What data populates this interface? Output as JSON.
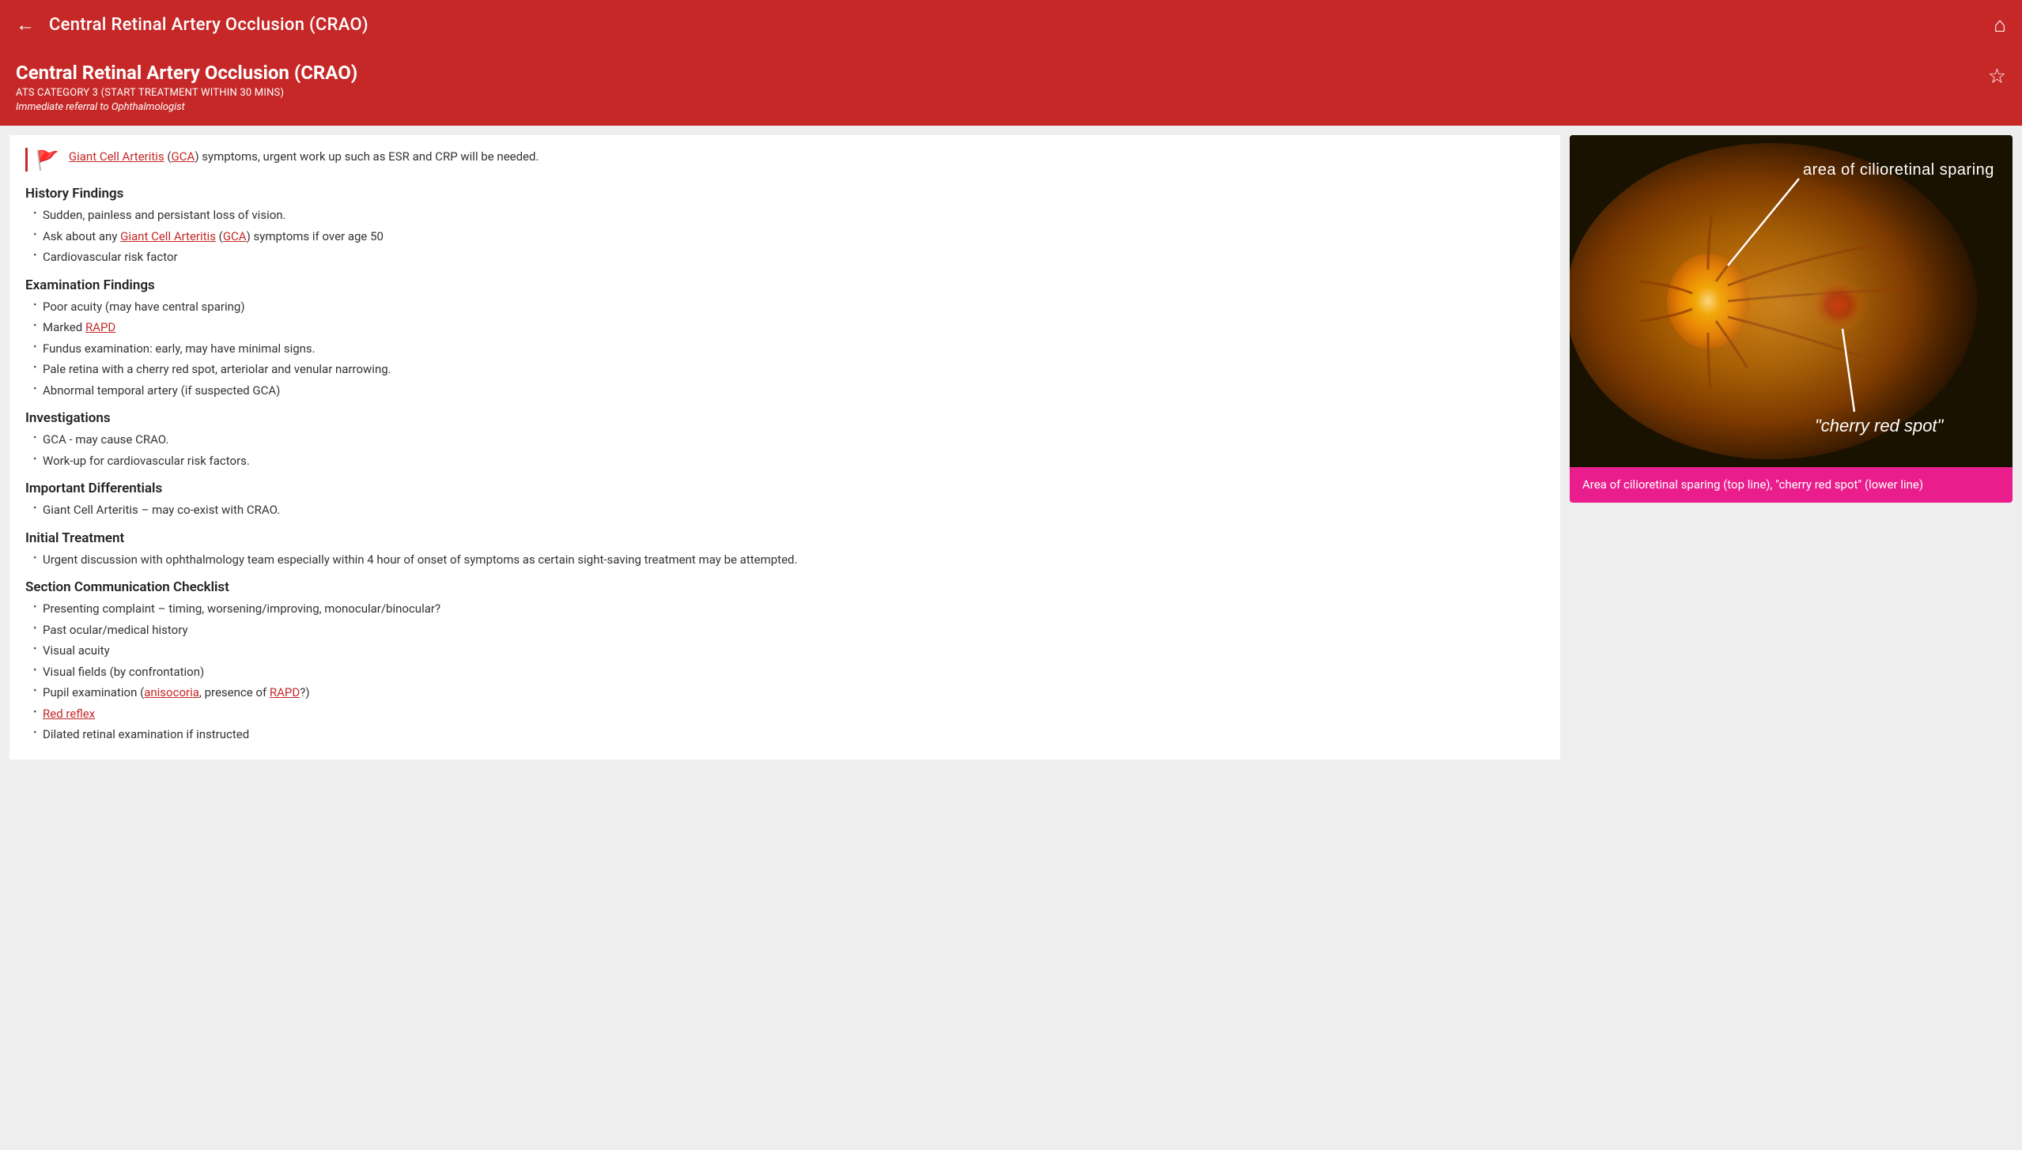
{
  "topbar": {
    "title": "Central Retinal Artery Occlusion (CRAO)",
    "back_label": "←",
    "home_label": "⌂"
  },
  "header": {
    "title": "Central Retinal Artery Occlusion (CRAO)",
    "category": "ATS CATEGORY 3 (START TREATMENT WITHIN 30 MINS)",
    "referral": "Immediate referral to Ophthalmologist",
    "star_label": "☆"
  },
  "alert": {
    "flag": "🚩",
    "text_before": "",
    "link1_text": "Giant Cell Arteritis",
    "link1_href": "#",
    "paren1_open": " (",
    "link2_text": "GCA",
    "link2_href": "#",
    "paren1_close": ")",
    "text_after": " symptoms, urgent work up such as ESR and CRP will be needed."
  },
  "sections": [
    {
      "id": "history",
      "heading": "History Findings",
      "items": [
        {
          "text": "Sudden, painless and persistant loss of vision.",
          "links": []
        },
        {
          "text": "Ask about any __Giant Cell Arteritis__ (__GCA__) symptoms if over age 50",
          "links": [
            "Giant Cell Arteritis",
            "GCA"
          ],
          "plain_parts": [
            "Ask about any ",
            " (",
            ") symptoms if over age 50"
          ]
        },
        {
          "text": "Cardiovascular risk factor",
          "links": []
        }
      ]
    },
    {
      "id": "examination",
      "heading": "Examination Findings",
      "items": [
        {
          "text": "Poor acuity (may have central sparing)",
          "links": []
        },
        {
          "text": "Marked __RAPD__",
          "links": [
            "RAPD"
          ],
          "plain_parts": [
            "Marked "
          ]
        },
        {
          "text": "Fundus examination: early, may have minimal signs.",
          "links": []
        },
        {
          "text": "Pale retina with a cherry red spot, arteriolar and venular narrowing.",
          "links": []
        },
        {
          "text": "Abnormal temporal artery (if suspected GCA)",
          "links": []
        }
      ]
    },
    {
      "id": "investigations",
      "heading": "Investigations",
      "items": [
        {
          "text": "GCA - may cause CRAO.",
          "links": []
        },
        {
          "text": "Work-up for cardiovascular risk factors.",
          "links": []
        }
      ]
    },
    {
      "id": "differentials",
      "heading": "Important Differentials",
      "items": [
        {
          "text": "Giant Cell Arteritis – may co-exist with CRAO.",
          "links": []
        }
      ]
    },
    {
      "id": "treatment",
      "heading": "Initial Treatment",
      "items": [
        {
          "text": "Urgent discussion with ophthalmology team especially within 4 hour of onset of symptoms as certain sight-saving treatment may be attempted.",
          "links": []
        }
      ]
    },
    {
      "id": "checklist",
      "heading": "Section Communication Checklist",
      "items": [
        {
          "text": "Presenting complaint – timing, worsening/improving, monocular/binocular?",
          "links": []
        },
        {
          "text": "Past ocular/medical history",
          "links": []
        },
        {
          "text": "Visual acuity",
          "links": []
        },
        {
          "text": "Visual fields (by confrontation)",
          "links": []
        },
        {
          "text": "Pupil examination (__anisocoria__, presence of __RAPD__?)",
          "links": [
            "anisocoria",
            "RAPD"
          ],
          "plain_parts": [
            "Pupil examination (",
            ", presence of ",
            "?)"
          ]
        },
        {
          "text": "__Red reflex__",
          "links": [
            "Red reflex"
          ],
          "plain_parts": [
            ""
          ]
        },
        {
          "text": "Dilated retinal examination if instructed",
          "links": []
        }
      ]
    }
  ],
  "image": {
    "caption": "Area of cilioretinal sparing (top line), \"cherry red spot\" (lower line)",
    "label_top": "area of cilioretinal sparing",
    "label_bottom": "\"cherry red spot\""
  }
}
